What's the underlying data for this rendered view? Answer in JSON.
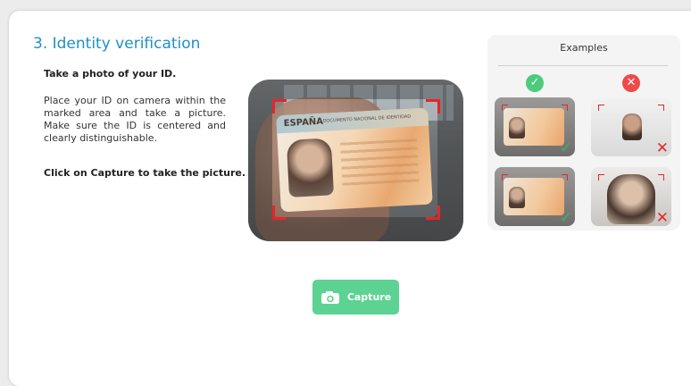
{
  "step": {
    "title": "3. Identity verification",
    "lead": "Take a photo of your ID.",
    "instructions": "Place your ID on camera within the marked area and take a picture. Make sure the ID is centered and clearly distinguishable.",
    "cta": "Click on Capture to take the picture."
  },
  "camera_preview": {
    "card_country": "ESPAÑA",
    "card_subtitle": "DOCUMENTO NACIONAL DE IDENTIDAD"
  },
  "examples": {
    "title": "Examples",
    "good_badge": "✓",
    "bad_badge": "✕",
    "good_mark": "✓",
    "bad_mark": "✕"
  },
  "capture_button": {
    "label": "Capture",
    "icon": "camera-icon"
  },
  "colors": {
    "title": "#1f8fc8",
    "button": "#5cd393",
    "good": "#4ccb7d",
    "bad": "#ee4a4a",
    "frame": "#e4262b"
  }
}
